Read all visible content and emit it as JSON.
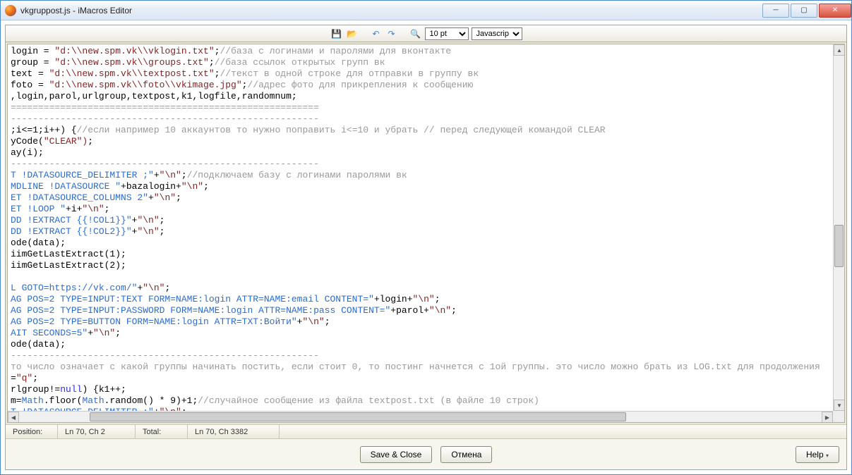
{
  "window": {
    "title": "vkgruppost.js - iMacros Editor"
  },
  "toolbar": {
    "fontsize": "10 pt",
    "language": "Javascript"
  },
  "status": {
    "pos_label": "Position:",
    "pos_value": "Ln 70, Ch 2",
    "total_label": "Total:",
    "total_value": "Ln 70, Ch 3382"
  },
  "footer": {
    "save_close": "Save & Close",
    "cancel": "Отмена",
    "help": "Help"
  },
  "code": {
    "l1a": "login = ",
    "l1b": "\"d:\\\\new.spm.vk\\\\vklogin.txt\"",
    "l1c": ";",
    "l1d": "//база с логинами и паролями для вконтакте",
    "l2a": "group = ",
    "l2b": "\"d:\\\\new.spm.vk\\\\groups.txt\"",
    "l2c": ";",
    "l2d": "//база ссылок открытых групп вк",
    "l3a": "text = ",
    "l3b": "\"d:\\\\new.spm.vk\\\\textpost.txt\"",
    "l3c": ";",
    "l3d": "//текст в одной строке для отправки в группу вк",
    "l4a": "foto = ",
    "l4b": "\"d:\\\\new.spm.vk\\\\foto\\\\vkimage.jpg\"",
    "l4c": ";",
    "l4d": "//адрес фото для прикрепления к сообщению",
    "l5": ",login,parol,urlgroup,textpost,k1,logfile,randomnum;",
    "l6": "========================================================",
    "l7": "--------------------------------------------------------",
    "l8a": ";i<=1;i++) {",
    "l8b": "//если например 10 аккаунтов то нужно поправить i<=10 и убрать // перед следующей командой CLEAR",
    "l9a": "yCode(",
    "l9b": "\"CLEAR\")",
    "l9c": ";",
    "l10": "ay(i);",
    "l11": "--------------------------------------------------------",
    "l12a": "T !DATASOURCE_DELIMITER ;\"",
    "l12b": "+",
    "l12c": "\"\\n\"",
    "l12d": ";",
    "l12e": "//подключаем базу с логинами паролями вк",
    "l13a": "MDLINE !DATASOURCE \"",
    "l13b": "+bazalogin+",
    "l13c": "\"\\n\"",
    "l13d": ";",
    "l14a": "ET !DATASOURCE_COLUMNS 2\"",
    "l14b": "+",
    "l14c": "\"\\n\"",
    "l14d": ";",
    "l15a": "ET !LOOP \"",
    "l15b": "+i+",
    "l15c": "\"\\n\"",
    "l15d": ";",
    "l16a": "DD !EXTRACT {{!COL1}}\"",
    "l16b": "+",
    "l16c": "\"\\n\"",
    "l16d": ";",
    "l17a": "DD !EXTRACT {{!COL2}}\"",
    "l17b": "+",
    "l17c": "\"\\n\"",
    "l17d": ";",
    "l18": "ode(data);",
    "l19": "iimGetLastExtract(1);",
    "l20": "iimGetLastExtract(2);",
    "l21a": "L GOTO=https://vk.com/\"",
    "l21b": "+",
    "l21c": "\"\\n\"",
    "l21d": ";",
    "l22a": "AG POS=2 TYPE=INPUT:TEXT FORM=NAME:login ATTR=NAME:email CONTENT=\"",
    "l22b": "+login+",
    "l22c": "\"\\n\"",
    "l22d": ";",
    "l23a": "AG POS=2 TYPE=INPUT:PASSWORD FORM=NAME:login ATTR=NAME:pass CONTENT=\"",
    "l23b": "+parol+",
    "l23c": "\"\\n\"",
    "l23d": ";",
    "l24a": "AG POS=2 TYPE=BUTTON FORM=NAME:login ATTR=TXT:Войти\"",
    "l24b": "+",
    "l24c": "\"\\n\"",
    "l24d": ";",
    "l25a": "AIT SECONDS=5\"",
    "l25b": "+",
    "l25c": "\"\\n\"",
    "l25d": ";",
    "l26": "ode(data);",
    "l27": "--------------------------------------------------------",
    "l28": "то число означает с какой группы начинать постить, если стоит 0, то постинг начнется с 1ой группы. это число можно брать из LOG.txt для продолжения",
    "l29a": "=",
    "l29b": "\"q\"",
    "l29c": ";",
    "l30a": "rlgroup!=",
    "l30b": "null",
    "l30c": ") {k1++;",
    "l31a": "m=",
    "l31b": "Math",
    "l31c": ".floor(",
    "l31d": "Math",
    "l31e": ".random() * 9)+1;",
    "l31f": "//случайное сообщение из файла textpost.txt (в файле 10 строк)",
    "l32a": "T !DATASOURCE_DELIMITER ;\"",
    "l32b": "+",
    "l32c": "\"\\n\"",
    "l32d": ";"
  }
}
